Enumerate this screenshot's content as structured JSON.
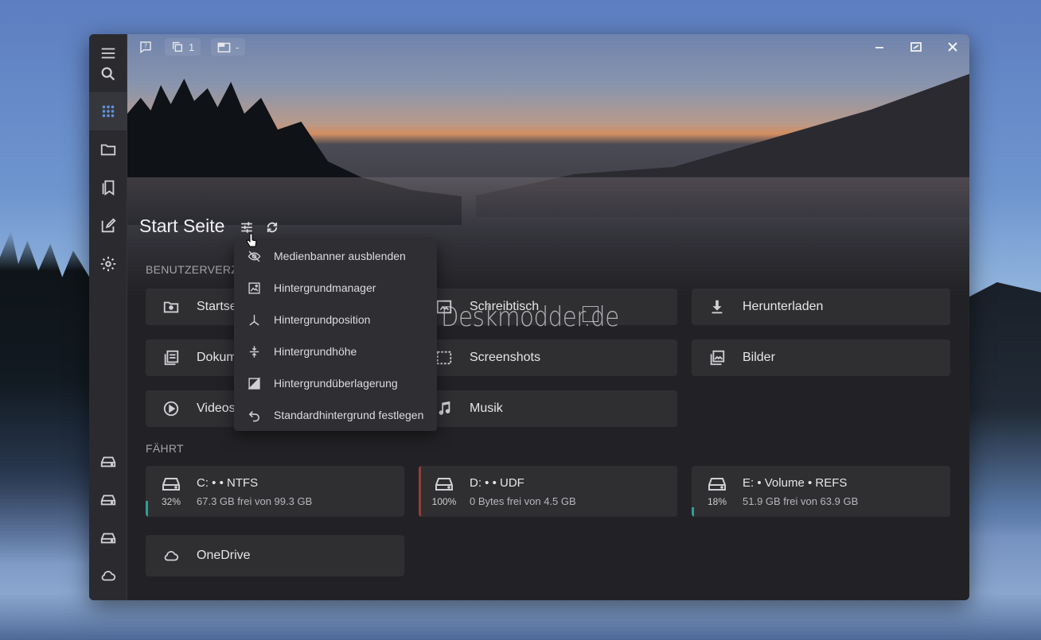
{
  "toolbar": {
    "help_icon": "help-box-icon",
    "copy_count": "1",
    "tab_label": "-"
  },
  "page": {
    "title": "Start Seite"
  },
  "sections": {
    "user_dirs": "BENUTZERVERZE",
    "drives": "FÄHRT"
  },
  "tiles": [
    {
      "label": "Startse",
      "icon": "home-folder-icon"
    },
    {
      "label": "Schreibtisch",
      "icon": "desktop-icon"
    },
    {
      "label": "Herunterladen",
      "icon": "download-icon"
    },
    {
      "label": "Dokum",
      "icon": "documents-icon"
    },
    {
      "label": "Screenshots",
      "icon": "screenshots-icon"
    },
    {
      "label": "Bilder",
      "icon": "pictures-icon"
    },
    {
      "label": "Videos",
      "icon": "play-circle-icon"
    },
    {
      "label": "Musik",
      "icon": "music-note-icon"
    }
  ],
  "drives": [
    {
      "name": "C: • • NTFS",
      "free": "67.3 GB frei von 99.3 GB",
      "percent": "32%",
      "used_fraction": 0.32,
      "bar_color": "#2aa198"
    },
    {
      "name": "D: • • UDF",
      "free": "0 Bytes frei von 4.5 GB",
      "percent": "100%",
      "used_fraction": 1.0,
      "bar_color": "#b8463f"
    },
    {
      "name": "E: • Volume • REFS",
      "free": "51.9 GB frei von 63.9 GB",
      "percent": "18%",
      "used_fraction": 0.18,
      "bar_color": "#2aa198"
    }
  ],
  "cloud": {
    "label": "OneDrive"
  },
  "menu": [
    {
      "label": "Medienbanner ausblenden",
      "icon": "eye-off-icon"
    },
    {
      "label": "Hintergrundmanager",
      "icon": "image-edit-icon"
    },
    {
      "label": "Hintergrundposition",
      "icon": "axis-icon"
    },
    {
      "label": "Hintergrundhöhe",
      "icon": "height-icon"
    },
    {
      "label": "Hintergrundüberlagerung",
      "icon": "overlay-icon"
    },
    {
      "label": "Standardhintergrund festlegen",
      "icon": "undo-icon"
    }
  ],
  "watermark": "Deskmodder.de"
}
